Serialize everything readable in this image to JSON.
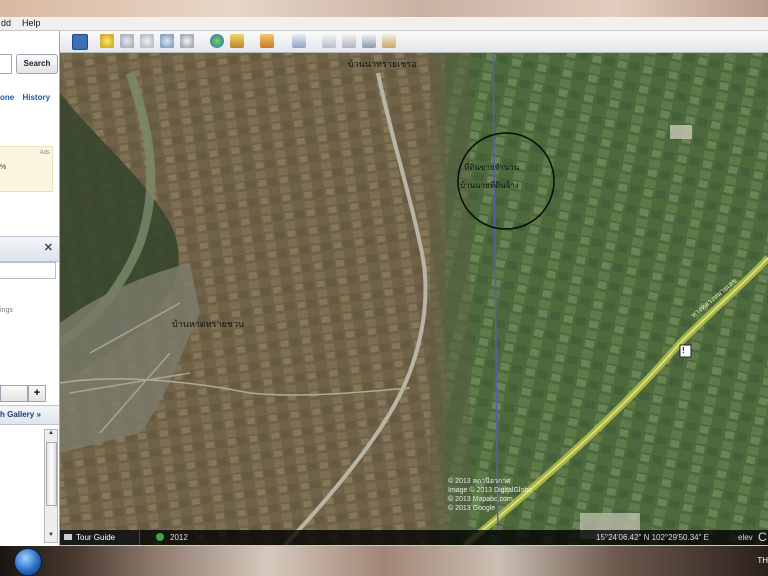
{
  "menu": {
    "items": [
      "dd",
      "Help"
    ]
  },
  "sidebar": {
    "search_button": "Search",
    "tabs": [
      "one",
      "History"
    ],
    "ad_text": "%",
    "ad_label": "Ads",
    "close_glyph": "✕",
    "ings_text": "ings",
    "plus_button": "+",
    "gallery_label": "h Gallery »",
    "scroll_up": "▲",
    "scroll_down": "▼"
  },
  "map": {
    "place_labels": [
      "บ้านนาทรายเชรอ",
      "บ้านหาดทรายชวน",
      "ที่ดินขายจำนวน",
      "บ้านนายที่ดินจ้าง"
    ],
    "route_shield": "!",
    "road_label": "ทางหลวงหมายเลข"
  },
  "imagery_credits": [
    "© 2013 สถานีอวกาศ",
    "Image © 2013 DigitalGlobe",
    "© 2013 Mapabc.com",
    "© 2013 Google"
  ],
  "status": {
    "tour_guide": "Tour Guide",
    "year": "2012",
    "coordinates": "15°24'06.42\" N  102°29'50.34\" E",
    "elev_label": "elev",
    "mode": "C"
  },
  "taskbar": {
    "tray_text": "TH"
  },
  "colors": {
    "map_dark": "#2e3a22",
    "map_light": "#8a7f62",
    "highway": "#a8b640",
    "circle": "#0a0a0a",
    "sidebar_link": "#1e5aa8"
  }
}
